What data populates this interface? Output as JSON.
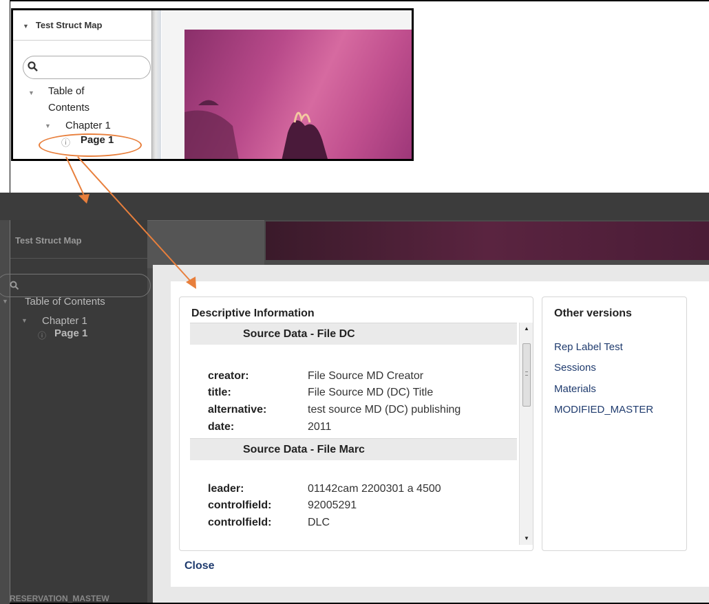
{
  "inset": {
    "panel_title": "Test Struct Map",
    "tree": {
      "root_line1": "Table of",
      "root_line2": "Contents",
      "chapter": "Chapter 1",
      "page": "Page 1"
    }
  },
  "background_app": {
    "panel_title": "Test Struct Map",
    "tree": {
      "root": "Table of Contents",
      "chapter": "Chapter 1",
      "page": "Page 1"
    },
    "footer_text": "RESERVATION_MASTEW"
  },
  "modal": {
    "descriptive": {
      "title": "Descriptive Information",
      "sections": [
        {
          "heading": "Source Data - File DC",
          "fields": [
            {
              "key": "creator:",
              "value": "File Source MD Creator"
            },
            {
              "key": "title:",
              "value": "File Source MD (DC) Title"
            },
            {
              "key": "alternative:",
              "value": "test source MD (DC) publishing"
            },
            {
              "key": "date:",
              "value": "2011"
            }
          ]
        },
        {
          "heading": "Source Data - File Marc",
          "fields": [
            {
              "key": "leader:",
              "value": "01142cam 2200301 a 4500"
            },
            {
              "key": "controlfield:",
              "value": "92005291"
            },
            {
              "key": "controlfield:",
              "value": "DLC"
            }
          ]
        }
      ]
    },
    "other_versions": {
      "title": "Other versions",
      "links": [
        "Rep Label Test",
        "Sessions",
        "Materials",
        "MODIFIED_MASTER"
      ]
    },
    "close_label": "Close"
  },
  "colors": {
    "annotation_orange": "#e87f3c",
    "link_blue": "#1f3b6e"
  }
}
